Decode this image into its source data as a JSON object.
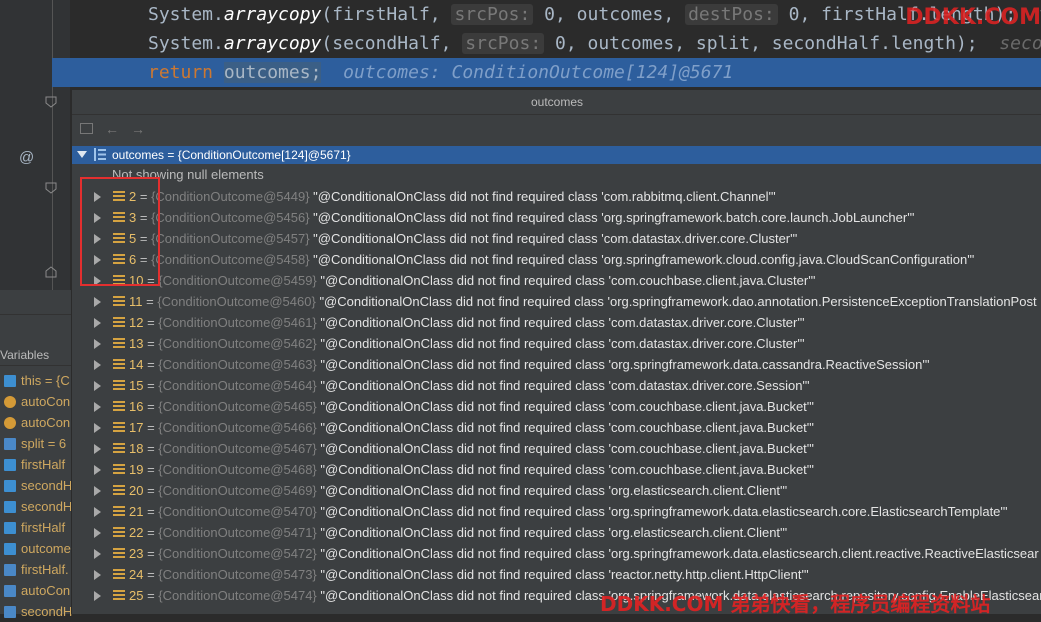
{
  "editor": {
    "line1": {
      "prefix": "System.",
      "method": "arraycopy",
      "arg1": "(firstHalf,",
      "hint1": "srcPos:",
      "mid": "0, outcomes,",
      "hint2": "destPos:",
      "tail": "0, firstHalf.length);",
      "trailing": "fi"
    },
    "line2": {
      "prefix": "System.",
      "method": "arraycopy",
      "arg1": "(secondHalf,",
      "hint1": "srcPos:",
      "tail": "0, outcomes, split, secondHalf.length);",
      "trailing": "seco"
    },
    "line3": {
      "keyword": "return",
      "var": "outcomes;",
      "inline_value": "outcomes: ConditionOutcome[124]@5671"
    }
  },
  "debug_panel": {
    "tab": "Variables",
    "vars": [
      {
        "icon": "list",
        "label": "this = {C"
      },
      {
        "icon": "p",
        "label": "autoCon"
      },
      {
        "icon": "p",
        "label": "autoCon"
      },
      {
        "icon": "oi",
        "label": "split = 6"
      },
      {
        "icon": "list",
        "label": "firstHalf"
      },
      {
        "icon": "list",
        "label": "secondH"
      },
      {
        "icon": "list",
        "label": "secondH"
      },
      {
        "icon": "list",
        "label": "firstHalf"
      },
      {
        "icon": "list",
        "label": "outcome"
      },
      {
        "icon": "oi",
        "label": "firstHalf."
      },
      {
        "icon": "oi",
        "label": "autoCon"
      },
      {
        "icon": "oi",
        "label": "secondH"
      }
    ]
  },
  "popup": {
    "title": "outcomes",
    "root": "outcomes = {ConditionOutcome[124]@5671}",
    "note": "Not showing null elements",
    "rows": [
      {
        "index": "2",
        "ref": "{ConditionOutcome@5449}",
        "message": "\"@ConditionalOnClass did not find required class 'com.rabbitmq.client.Channel'\""
      },
      {
        "index": "3",
        "ref": "{ConditionOutcome@5456}",
        "message": "\"@ConditionalOnClass did not find required class 'org.springframework.batch.core.launch.JobLauncher'\""
      },
      {
        "index": "5",
        "ref": "{ConditionOutcome@5457}",
        "message": "\"@ConditionalOnClass did not find required class 'com.datastax.driver.core.Cluster'\""
      },
      {
        "index": "6",
        "ref": "{ConditionOutcome@5458}",
        "message": "\"@ConditionalOnClass did not find required class 'org.springframework.cloud.config.java.CloudScanConfiguration'\""
      },
      {
        "index": "10",
        "ref": "{ConditionOutcome@5459}",
        "message": "\"@ConditionalOnClass did not find required class 'com.couchbase.client.java.Cluster'\""
      },
      {
        "index": "11",
        "ref": "{ConditionOutcome@5460}",
        "message": "\"@ConditionalOnClass did not find required class 'org.springframework.dao.annotation.PersistenceExceptionTranslationPost"
      },
      {
        "index": "12",
        "ref": "{ConditionOutcome@5461}",
        "message": "\"@ConditionalOnClass did not find required class 'com.datastax.driver.core.Cluster'\""
      },
      {
        "index": "13",
        "ref": "{ConditionOutcome@5462}",
        "message": "\"@ConditionalOnClass did not find required class 'com.datastax.driver.core.Cluster'\""
      },
      {
        "index": "14",
        "ref": "{ConditionOutcome@5463}",
        "message": "\"@ConditionalOnClass did not find required class 'org.springframework.data.cassandra.ReactiveSession'\""
      },
      {
        "index": "15",
        "ref": "{ConditionOutcome@5464}",
        "message": "\"@ConditionalOnClass did not find required class 'com.datastax.driver.core.Session'\""
      },
      {
        "index": "16",
        "ref": "{ConditionOutcome@5465}",
        "message": "\"@ConditionalOnClass did not find required class 'com.couchbase.client.java.Bucket'\""
      },
      {
        "index": "17",
        "ref": "{ConditionOutcome@5466}",
        "message": "\"@ConditionalOnClass did not find required class 'com.couchbase.client.java.Bucket'\""
      },
      {
        "index": "18",
        "ref": "{ConditionOutcome@5467}",
        "message": "\"@ConditionalOnClass did not find required class 'com.couchbase.client.java.Bucket'\""
      },
      {
        "index": "19",
        "ref": "{ConditionOutcome@5468}",
        "message": "\"@ConditionalOnClass did not find required class 'com.couchbase.client.java.Bucket'\""
      },
      {
        "index": "20",
        "ref": "{ConditionOutcome@5469}",
        "message": "\"@ConditionalOnClass did not find required class 'org.elasticsearch.client.Client'\""
      },
      {
        "index": "21",
        "ref": "{ConditionOutcome@5470}",
        "message": "\"@ConditionalOnClass did not find required class 'org.springframework.data.elasticsearch.core.ElasticsearchTemplate'\""
      },
      {
        "index": "22",
        "ref": "{ConditionOutcome@5471}",
        "message": "\"@ConditionalOnClass did not find required class 'org.elasticsearch.client.Client'\""
      },
      {
        "index": "23",
        "ref": "{ConditionOutcome@5472}",
        "message": "\"@ConditionalOnClass did not find required class 'org.springframework.data.elasticsearch.client.reactive.ReactiveElasticsear"
      },
      {
        "index": "24",
        "ref": "{ConditionOutcome@5473}",
        "message": "\"@ConditionalOnClass did not find required class 'reactor.netty.http.client.HttpClient'\""
      },
      {
        "index": "25",
        "ref": "{ConditionOutcome@5474}",
        "message": "\"@ConditionalOnClass did not find required class 'org.springframework.data.elasticsearch.repository.config.EnableElasticsear"
      }
    ]
  },
  "watermarks": {
    "top": "DDKK.COM",
    "bottom": "DDKK.COM 弟弟快看，程序员编程资料站"
  },
  "colors": {
    "editor_bg": "#2b2b2b",
    "selection": "#2d5e9d",
    "keyword": "#cc7832",
    "index": "#e8bf6a",
    "highlight_box": "#e32f2f"
  }
}
